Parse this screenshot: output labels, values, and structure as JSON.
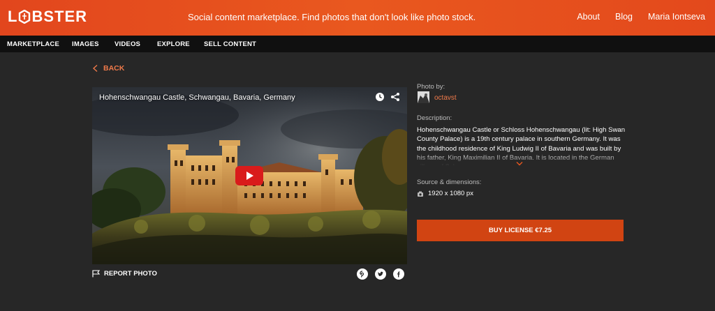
{
  "header": {
    "logo_text_l": "L",
    "logo_text_rest": "BSTER",
    "logo_full": "LOBSTER",
    "tagline": "Social content marketplace. Find photos that don't look like photo stock.",
    "links": [
      "About",
      "Blog",
      "Maria Iontseva"
    ]
  },
  "nav": {
    "items": [
      "MARKETPLACE",
      "IMAGES",
      "VIDEOS",
      "EXPLORE",
      "SELL CONTENT"
    ]
  },
  "back_label": "BACK",
  "media": {
    "title": "Hohenschwangau Castle, Schwangau, Bavaria, Germany",
    "icons": [
      "clock-icon",
      "share-icon",
      "play-icon"
    ]
  },
  "report_label": "REPORT PHOTO",
  "social": [
    "pinterest-icon",
    "twitter-icon",
    "facebook-icon"
  ],
  "sidebar": {
    "photo_by_label": "Photo by:",
    "author": "octavst",
    "description_label": "Description:",
    "description": "Hohenschwangau Castle or Schloss Hohenschwangau (lit: High Swan County Palace) is a 19th century palace in southern Germany. It was the childhood residence of King Ludwig II of Bavaria and was built by his father, King Maximilian II of Bavaria. It is located in the German village of Schwangau.",
    "source_label": "Source & dimensions:",
    "dimensions": "1920 x 1080 px",
    "buy_label": "BUY LICENSE €7.25"
  },
  "colors": {
    "header_orange": "#e9581f",
    "accent": "#f07a4a",
    "buy_button": "#d14412",
    "background": "#272727",
    "nav_bg": "#101010"
  }
}
